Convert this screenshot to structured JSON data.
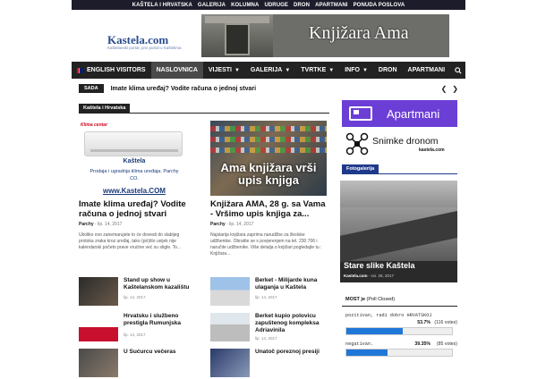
{
  "topbar": [
    "KAŠTELA I HRVATSKA",
    "GALERIJA",
    "KOLUMNA",
    "UDRUGE",
    "DRON",
    "APARTMANI",
    "PONUDA POSLOVA"
  ],
  "logo": {
    "title": "Kastela.com",
    "tagline": "Kaštelanski portal, prvi portal u Kaštelima"
  },
  "banner": {
    "title": "Knjižara Ama"
  },
  "nav": {
    "items": [
      {
        "label": "ENGLISH VISITORS"
      },
      {
        "label": "NASLOVNICA"
      },
      {
        "label": "VIJESTI"
      },
      {
        "label": "GALERIJA"
      },
      {
        "label": "TVRTKE"
      },
      {
        "label": "INFO"
      },
      {
        "label": "DRON"
      },
      {
        "label": "APARTMANI"
      }
    ]
  },
  "ticker": {
    "badge": "SADA",
    "text": "Imate klima uređaj? Vodite računa o jednoj stvari"
  },
  "section": {
    "label": "Kaštela i Hrvatska"
  },
  "cards": [
    {
      "img": {
        "brand": "Klima centar",
        "city": "Kaštela",
        "offer": "Prodaja i ugradnja klima uređaja. Parchy CO.",
        "url": "www.Kastela.COM"
      },
      "title": "Imate klima uređaj? Vodite računa o jednoj stvari",
      "author": "Parchy",
      "date": "lip. 14, 2017",
      "excerpt": "Ukoliko ovo zanemarujete to će dovesti do slabijeg protoka zraka kroz uređaj, tako (pri)što uvijek nije kalendarski početo prave vrućine već su stigle. To..."
    },
    {
      "img": {
        "caption": "Ama knjižara vrši upis knjiga"
      },
      "title": "Knjižara AMA, 28 g. sa Vama - Vršimo upis knjiga za...",
      "author": "Parchy",
      "date": "lip. 14, 2017",
      "excerpt": "Najstarija knjižara zaprima narudžbe za školske udžbenike. Obratite se s povjerenjem na tel. 230 706 i naručite udžbenike. Više detalja o knjižari pogledajte tu : Knjižara..."
    }
  ],
  "list_left": [
    {
      "title": "Stand up show u Kaštelanskom kazalištu",
      "date": "lip. 14, 2017"
    },
    {
      "title": "Hrvatsku i službeno prestigla Rumunjska",
      "date": "lip. 14, 2017"
    },
    {
      "title": "U Sućurcu večeras",
      "date": ""
    }
  ],
  "list_right": [
    {
      "title": "Berket - Milijarde kuna ulaganja u Kaštela",
      "date": "lip. 14, 2017"
    },
    {
      "title": "Berket kupio polovicu zapuštenog kompleksa Adriavinila",
      "date": "lip. 14, 2017"
    },
    {
      "title": "Unatoč poreznoj presiji",
      "date": ""
    }
  ],
  "sidebar": {
    "ad_apartmani": "Apartmani",
    "ad_dron": {
      "title": "Snimke dronom",
      "sub": "kastela.com"
    },
    "label": "Fotogalerija",
    "gallery": {
      "title": "Stare slike Kaštela",
      "author": "Kastela.com",
      "date": "svi. 28, 2017"
    },
    "poll": {
      "title_bold": "MOST je",
      "title_rest": "(Poll Closed)",
      "options": [
        {
          "label": "pozitivan, radi dobro HRVATSKOJ",
          "pct": "53.7%",
          "votes": "(116 votes)",
          "fraction": 0.537
        },
        {
          "label": "negativan.",
          "pct": "39.35%",
          "votes": "(85 votes)",
          "fraction": 0.3935
        }
      ]
    }
  },
  "colors": {
    "accent": "#1f3a8a",
    "nav": "#222222",
    "apartmani": "#6b3fd6",
    "poll_bar": "#1f77d8"
  }
}
